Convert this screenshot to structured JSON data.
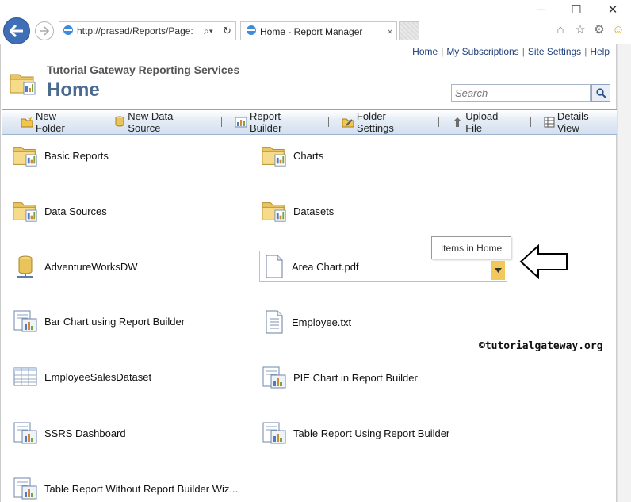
{
  "browser": {
    "url": "http://prasad/Reports/Page:",
    "tab_title": "Home - Report Manager",
    "tab_close": "×",
    "win_min": "─",
    "win_max": "☐",
    "win_close": "✕"
  },
  "header": {
    "links": [
      "Home",
      "My Subscriptions",
      "Site Settings",
      "Help"
    ],
    "site_name": "Tutorial Gateway Reporting Services",
    "page_title": "Home",
    "search_placeholder": "Search"
  },
  "toolbar": {
    "new_folder": "New Folder",
    "new_data_source": "New Data Source",
    "report_builder": "Report Builder",
    "folder_settings": "Folder Settings",
    "upload_file": "Upload File",
    "details_view": "Details View"
  },
  "items": [
    {
      "label": "Basic Reports",
      "icon": "folder-icon"
    },
    {
      "label": "Charts",
      "icon": "folder-icon"
    },
    {
      "label": "Data Sources",
      "icon": "folder-icon"
    },
    {
      "label": "Datasets",
      "icon": "folder-icon"
    },
    {
      "label": "AdventureWorksDW",
      "icon": "data-source-icon"
    },
    {
      "label": "Area Chart.pdf",
      "icon": "file-icon"
    },
    {
      "label": "Bar Chart using Report Builder",
      "icon": "report-icon"
    },
    {
      "label": "Employee.txt",
      "icon": "text-file-icon"
    },
    {
      "label": "EmployeeSalesDataset",
      "icon": "dataset-icon"
    },
    {
      "label": "PIE Chart in Report Builder",
      "icon": "report-icon"
    },
    {
      "label": "SSRS Dashboard",
      "icon": "report-icon"
    },
    {
      "label": "Table Report Using Report Builder",
      "icon": "report-icon"
    },
    {
      "label": "Table Report Without Report Builder Wiz...",
      "icon": "report-icon"
    }
  ],
  "tooltip": "Items in Home",
  "watermark": "©tutorialgateway.org",
  "colors": {
    "accent": "#4b6a8f",
    "selection": "#f2c85a",
    "link": "#1e3f7a"
  }
}
